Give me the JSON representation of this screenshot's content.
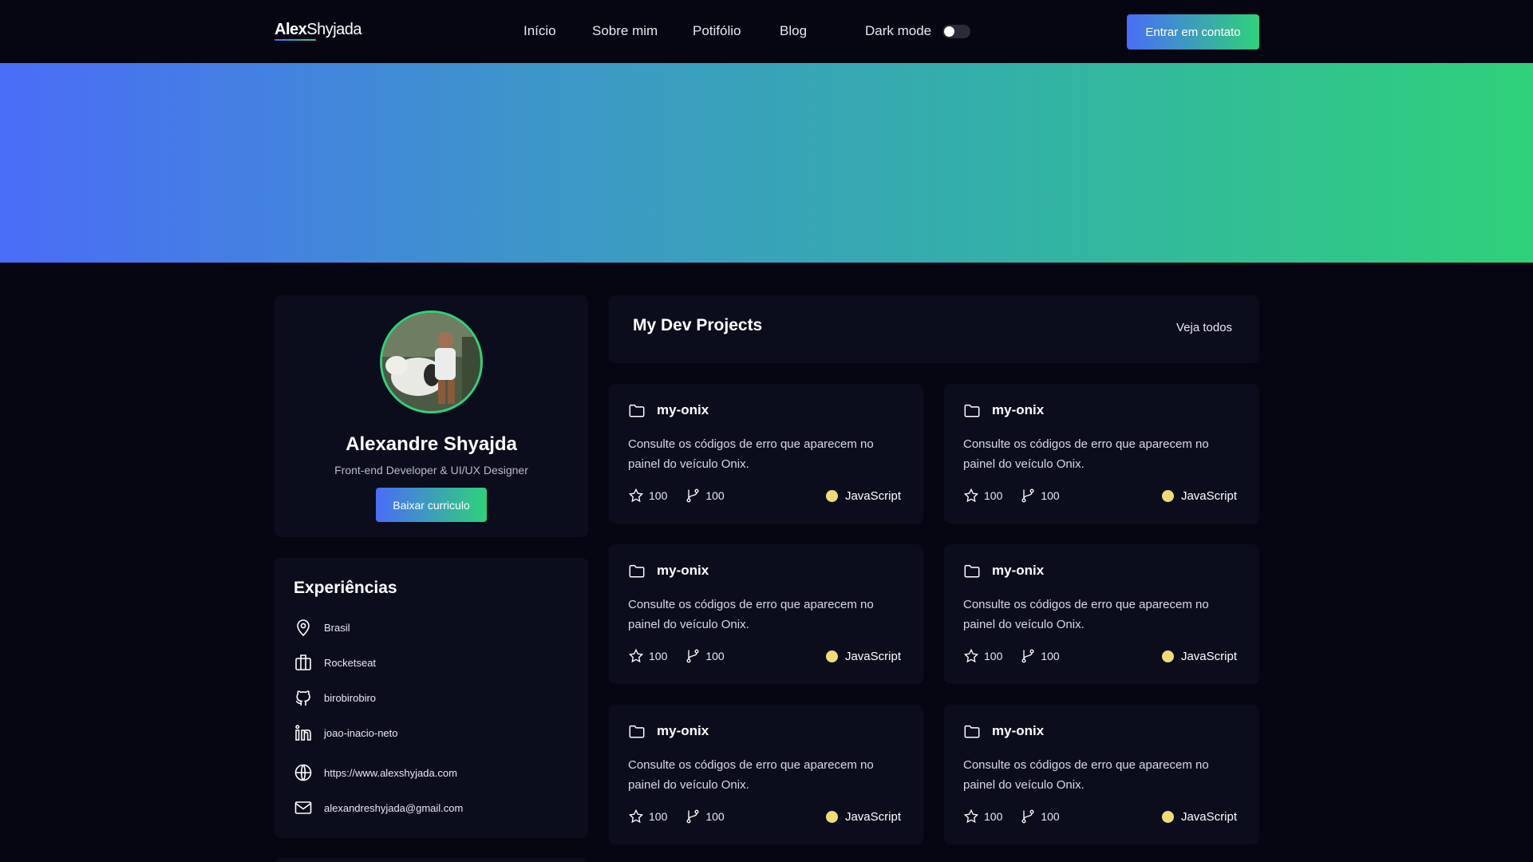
{
  "header": {
    "logo_part1": "Alex",
    "logo_part2": "Shyjada",
    "nav": [
      "Início",
      "Sobre mim",
      "Potifólio",
      "Blog"
    ],
    "dark_mode_label": "Dark mode",
    "dark_mode_on": false,
    "cta_label": "Entrar em contato"
  },
  "colors": {
    "background": "#060612",
    "card": "#0c0d1c",
    "gradient_start": "#4a6cf7",
    "gradient_end": "#2fd17a",
    "javascript_dot": "#f1dc74"
  },
  "profile": {
    "name": "Alexandre Shyajda",
    "role": "Front-end Developer & UI/UX Designer",
    "download_label": "Baixar curriculo"
  },
  "experiences": {
    "title": "Experiências",
    "items": [
      {
        "icon": "location-pin-icon",
        "text": "Brasil"
      },
      {
        "icon": "building-icon",
        "text": "Rocketseat"
      },
      {
        "icon": "github-icon",
        "text": "birobirobiro"
      },
      {
        "icon": "linkedin-icon",
        "text": "joao-inacio-neto"
      },
      {
        "icon": "globe-icon",
        "text": "https://www.alexshyjada.com"
      },
      {
        "icon": "mail-icon",
        "text": "alexandreshyjada@gmail.com"
      }
    ]
  },
  "projects": {
    "title": "My Dev Projects",
    "see_all": "Veja todos",
    "items": [
      {
        "name": "my-onix",
        "description": "Consulte os códigos de erro que aparecem no painel do veículo Onix.",
        "stars": "100",
        "forks": "100",
        "language": "JavaScript"
      },
      {
        "name": "my-onix",
        "description": "Consulte os códigos de erro que aparecem no painel do veículo Onix.",
        "stars": "100",
        "forks": "100",
        "language": "JavaScript"
      },
      {
        "name": "my-onix",
        "description": "Consulte os códigos de erro que aparecem no painel do veículo Onix.",
        "stars": "100",
        "forks": "100",
        "language": "JavaScript"
      },
      {
        "name": "my-onix",
        "description": "Consulte os códigos de erro que aparecem no painel do veículo Onix.",
        "stars": "100",
        "forks": "100",
        "language": "JavaScript"
      },
      {
        "name": "my-onix",
        "description": "Consulte os códigos de erro que aparecem no painel do veículo Onix.",
        "stars": "100",
        "forks": "100",
        "language": "JavaScript"
      },
      {
        "name": "my-onix",
        "description": "Consulte os códigos de erro que aparecem no painel do veículo Onix.",
        "stars": "100",
        "forks": "100",
        "language": "JavaScript"
      }
    ]
  }
}
